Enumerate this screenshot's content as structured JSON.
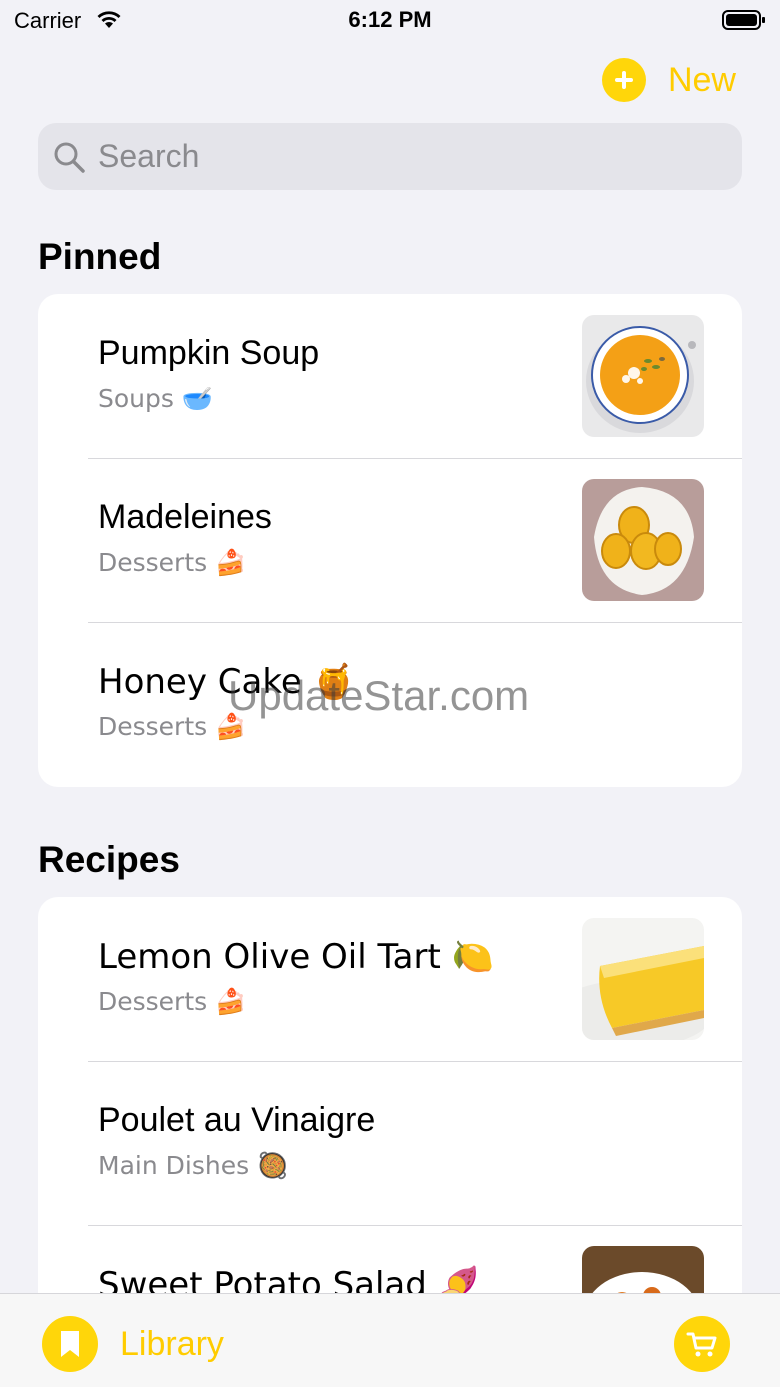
{
  "status_bar": {
    "carrier": "Carrier",
    "time": "6:12 PM"
  },
  "toolbar": {
    "new_label": "New"
  },
  "search": {
    "placeholder": "Search"
  },
  "pinned": {
    "title": "Pinned",
    "items": [
      {
        "title": "Pumpkin Soup",
        "category": "Soups 🥣",
        "thumbnail": "pumpkin-soup-photo"
      },
      {
        "title": "Madeleines",
        "category": "Desserts 🍰",
        "thumbnail": "madeleines-photo"
      },
      {
        "title": "Honey Cake 🍯",
        "category": "Desserts 🍰",
        "thumbnail": null
      }
    ]
  },
  "recipes": {
    "title": "Recipes",
    "items": [
      {
        "title": "Lemon Olive Oil Tart 🍋",
        "category": "Desserts 🍰",
        "thumbnail": "lemon-tart-photo"
      },
      {
        "title": "Poulet au Vinaigre",
        "category": "Main Dishes 🥘",
        "thumbnail": null
      },
      {
        "title": "Sweet Potato Salad 🍠",
        "category": "",
        "thumbnail": "sweet-potato-salad-photo"
      }
    ]
  },
  "tab_bar": {
    "library_label": "Library",
    "cart_icon": "cart-icon",
    "library_icon": "bookmark-icon"
  },
  "watermark": "UpdateStar.com",
  "colors": {
    "accent": "#ffd60a",
    "accent_text": "#ffcc00",
    "background": "#f2f2f7",
    "secondary_text": "#8a8a8e"
  }
}
